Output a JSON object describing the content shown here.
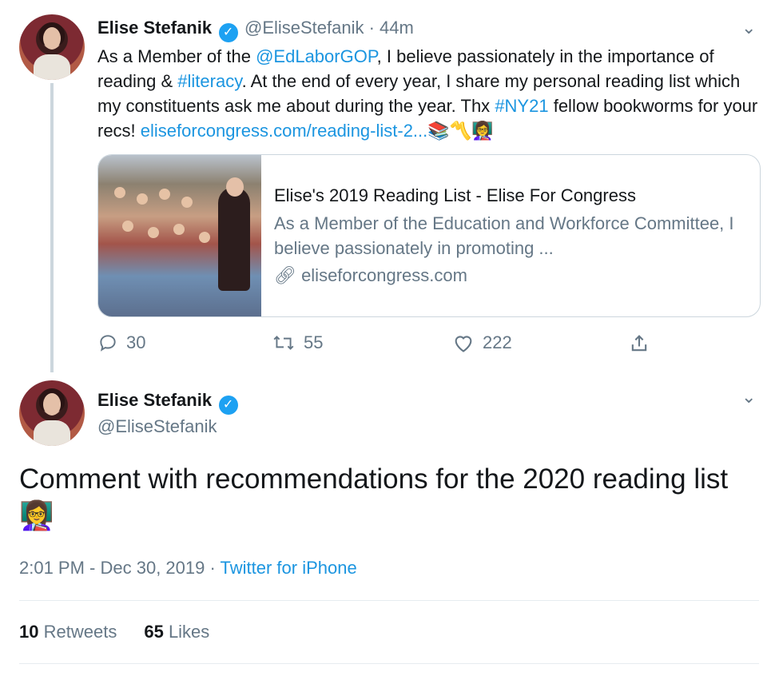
{
  "tweet1": {
    "name": "Elise Stefanik",
    "handle_time": "@EliseStefanik · 44m",
    "text_parts": [
      "As a Member of the ",
      "@EdLaborGOP",
      ", I believe passionately in the importance of reading & ",
      "#literacy",
      ". At the end of every year, I share my personal reading list which my constituents ask me about during the year. Thx ",
      "#NY21",
      " fellow bookworms for your recs! ",
      "eliseforcongress.com/reading-list-2...",
      " 📚〽️👩‍🏫"
    ],
    "card": {
      "title": "Elise's 2019 Reading List - Elise For Congress",
      "description": "As a Member of the Education and Workforce Committee, I believe passionately in promoting ...",
      "domain": "eliseforcongress.com"
    },
    "actions": {
      "replies": "30",
      "retweets": "55",
      "likes": "222"
    }
  },
  "tweet2": {
    "name": "Elise Stefanik",
    "handle": "@EliseStefanik",
    "text": "Comment with recommendations for the 2020 reading list 👩‍🏫",
    "time": "2:01 PM - Dec 30, 2019",
    "source": "Twitter for iPhone",
    "retweets_count": "10",
    "retweets_label": "Retweets",
    "likes_count": "65",
    "likes_label": "Likes"
  },
  "icons": {
    "verified": "verified-badge-icon",
    "chevron": "chevron-down-icon",
    "reply": "reply-icon",
    "retweet": "retweet-icon",
    "like": "heart-icon",
    "share": "share-icon",
    "link": "link-icon"
  },
  "colors": {
    "link": "#1b95e0",
    "verified": "#1da1f2",
    "secondary_text": "#657786"
  }
}
